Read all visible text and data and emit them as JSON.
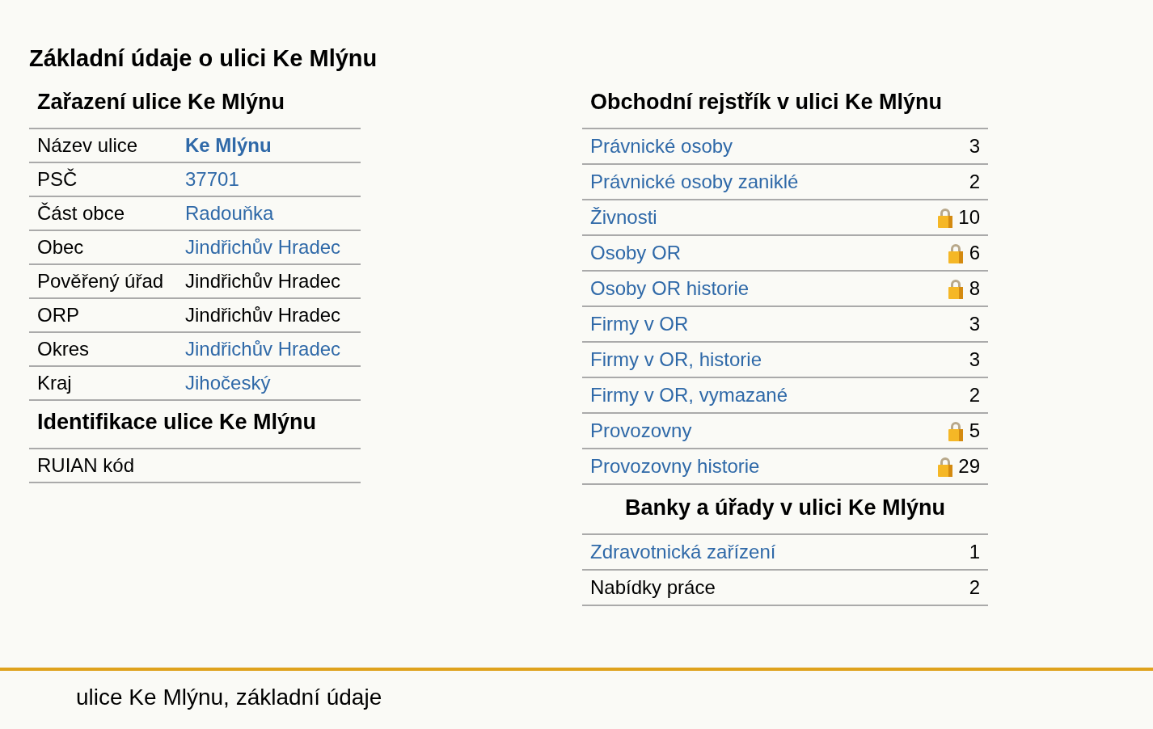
{
  "page_title": "Základní údaje o ulici Ke Mlýnu",
  "classification": {
    "title": "Zařazení ulice Ke Mlýnu",
    "rows": [
      {
        "label": "Název ulice",
        "value": "Ke Mlýnu",
        "kind": "strong-link"
      },
      {
        "label": "PSČ",
        "value": "37701",
        "kind": "link"
      },
      {
        "label": "Část obce",
        "value": "Radouňka",
        "kind": "link"
      },
      {
        "label": "Obec",
        "value": "Jindřichův Hradec",
        "kind": "link"
      },
      {
        "label": "Pověřený úřad",
        "value": "Jindřichův Hradec",
        "kind": "plain"
      },
      {
        "label": "ORP",
        "value": "Jindřichův Hradec",
        "kind": "plain"
      },
      {
        "label": "Okres",
        "value": "Jindřichův Hradec",
        "kind": "link"
      },
      {
        "label": "Kraj",
        "value": "Jihočeský",
        "kind": "link"
      }
    ]
  },
  "identification": {
    "title": "Identifikace ulice Ke Mlýnu",
    "rows": [
      {
        "label": "RUIAN kód"
      }
    ]
  },
  "register": {
    "title": "Obchodní rejstřík v ulici Ke Mlýnu",
    "rows": [
      {
        "label": "Právnické osoby",
        "count": "3",
        "kind": "link",
        "locked": false
      },
      {
        "label": "Právnické osoby zaniklé",
        "count": "2",
        "kind": "link",
        "locked": false
      },
      {
        "label": "Živnosti",
        "count": "10",
        "kind": "link",
        "locked": true
      },
      {
        "label": "Osoby OR",
        "count": "6",
        "kind": "link",
        "locked": true
      },
      {
        "label": "Osoby OR historie",
        "count": "8",
        "kind": "link",
        "locked": true
      },
      {
        "label": "Firmy v OR",
        "count": "3",
        "kind": "link",
        "locked": false
      },
      {
        "label": "Firmy v OR, historie",
        "count": "3",
        "kind": "link",
        "locked": false
      },
      {
        "label": "Firmy v OR, vymazané",
        "count": "2",
        "kind": "link",
        "locked": false
      },
      {
        "label": "Provozovny",
        "count": "5",
        "kind": "link",
        "locked": true
      },
      {
        "label": "Provozovny historie",
        "count": "29",
        "kind": "link",
        "locked": true
      }
    ]
  },
  "banks": {
    "title": "Banky a úřady v ulici Ke Mlýnu",
    "rows": [
      {
        "label": "Zdravotnická zařízení",
        "count": "1",
        "kind": "link",
        "locked": false
      },
      {
        "label": "Nabídky práce",
        "count": "2",
        "kind": "plain",
        "locked": false
      }
    ]
  },
  "footer": {
    "text": "ulice Ke Mlýnu, základní údaje"
  }
}
